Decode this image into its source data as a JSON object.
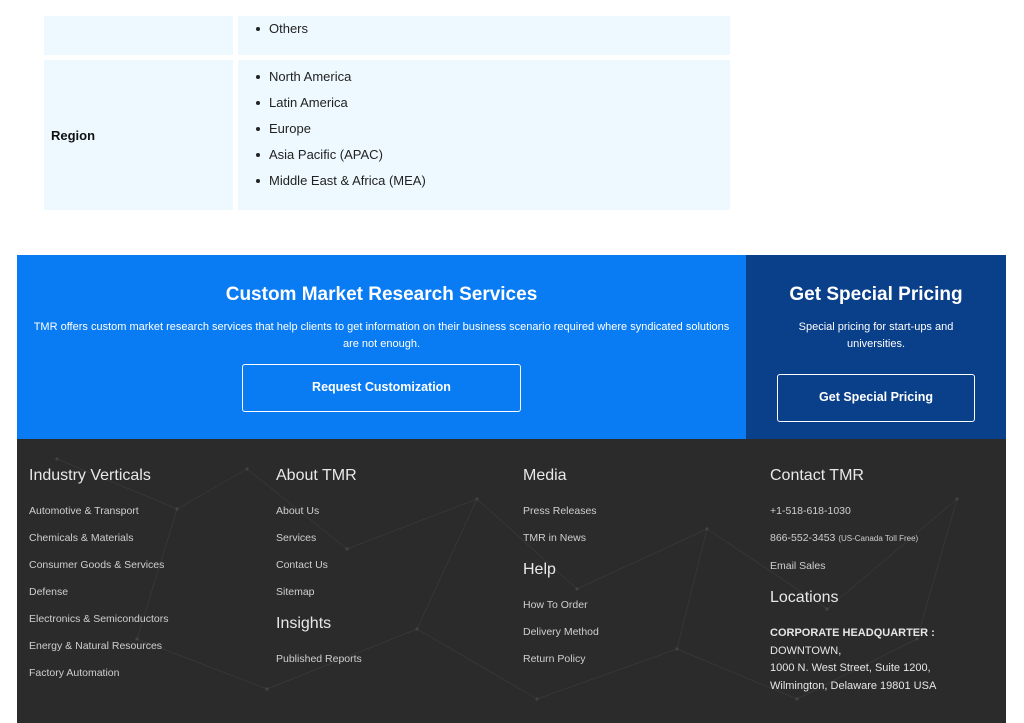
{
  "segments": {
    "prev_row": {
      "items": [
        "Others"
      ]
    },
    "region_row": {
      "label": "Region",
      "items": [
        "North America",
        "Latin America",
        "Europe",
        "Asia Pacific (APAC)",
        "Middle East & Africa (MEA)"
      ]
    }
  },
  "cta": {
    "custom": {
      "title": "Custom Market Research Services",
      "text": "TMR offers custom market research services that help clients to get information on their business scenario required where syndicated solutions are not enough.",
      "button": "Request Customization"
    },
    "pricing": {
      "title": "Get Special Pricing",
      "text": "Special pricing for start-ups and universities.",
      "button": "Get Special Pricing"
    },
    "colors": {
      "main": "#0a7cf3",
      "side": "#0a3f8a"
    }
  },
  "footer": {
    "industry": {
      "title": "Industry Verticals",
      "links": [
        "Automotive & Transport",
        "Chemicals & Materials",
        "Consumer Goods & Services",
        "Defense",
        "Electronics & Semiconductors",
        "Energy & Natural Resources",
        "Factory Automation"
      ]
    },
    "about": {
      "title": "About TMR",
      "links": [
        "About Us",
        "Services",
        "Contact Us",
        "Sitemap"
      ],
      "insights_title": "Insights",
      "insights_links": [
        "Published Reports"
      ]
    },
    "media": {
      "title": "Media",
      "links": [
        "Press Releases",
        "TMR in News"
      ],
      "help_title": "Help",
      "help_links": [
        "How To Order",
        "Delivery Method",
        "Return Policy"
      ]
    },
    "contact": {
      "title": "Contact TMR",
      "phone1": "+1-518-618-1030",
      "phone2": "866-552-3453",
      "phone2_note": "(US-Canada Toll Free)",
      "email": "Email Sales",
      "locations_title": "Locations",
      "hq_label": "CORPORATE HEADQUARTER :",
      "hq_lines": [
        "DOWNTOWN,",
        "1000 N. West Street, Suite 1200,",
        "Wilmington, Delaware 19801 USA"
      ]
    },
    "background": "#2b2b2b"
  }
}
